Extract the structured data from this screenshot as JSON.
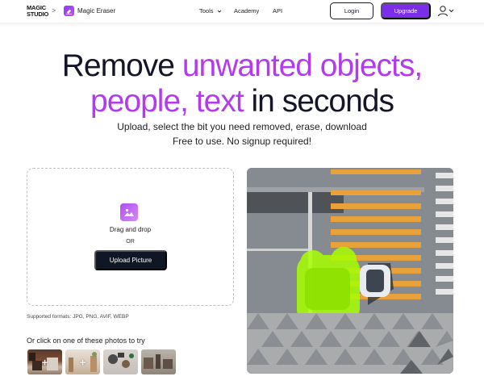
{
  "header": {
    "logo_line1": "MAGIC",
    "logo_line2": "STUDIO",
    "separator": ">",
    "app_icon": "magic-eraser-icon",
    "app_name": "Magic Eraser",
    "nav": {
      "tools": "Tools",
      "academy": "Academy",
      "api": "API"
    },
    "login_label": "Login",
    "upgrade_label": "Upgrade",
    "user_icon": "user-icon"
  },
  "hero": {
    "line1_plain": "Remove ",
    "line1_accent": "unwanted objects,",
    "line2_accent": "people, text",
    "line2_plain": " in seconds",
    "subtitle1": "Upload, select the bit you need removed, erase, download",
    "subtitle2": "Free to use. No signup required!"
  },
  "upload": {
    "icon": "image-icon",
    "drag_text": "Drag and drop",
    "or_text": "OR",
    "button_label": "Upload Picture",
    "formats_text": "Supported formats: JPG, PNG, AVIF, WEBP"
  },
  "samples": {
    "label": "Or click on one of these photos to try",
    "plus": "+"
  },
  "colors": {
    "accent_purple": "#b43af0",
    "upgrade_button": "#7a2ee8",
    "upload_button": "#0f1724",
    "highlight_green": "#a6ff00"
  }
}
